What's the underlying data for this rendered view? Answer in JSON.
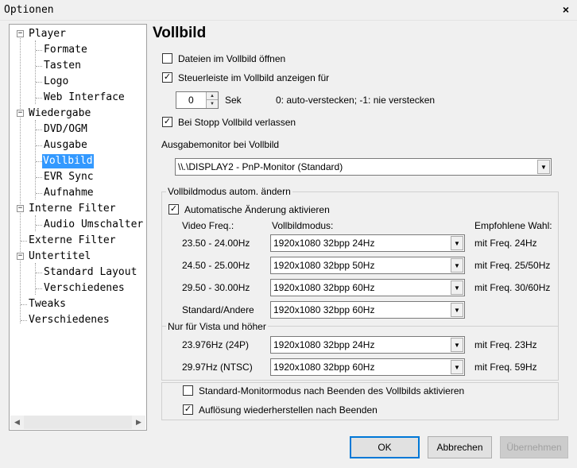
{
  "window": {
    "title": "Optionen",
    "close_glyph": "×"
  },
  "tree": {
    "items": [
      {
        "label": "Player",
        "level": 0,
        "expander": "⊟"
      },
      {
        "label": "Formate",
        "level": 1
      },
      {
        "label": "Tasten",
        "level": 1
      },
      {
        "label": "Logo",
        "level": 1
      },
      {
        "label": "Web Interface",
        "level": 1
      },
      {
        "label": "Wiedergabe",
        "level": 0,
        "expander": "⊟"
      },
      {
        "label": "DVD/OGM",
        "level": 1
      },
      {
        "label": "Ausgabe",
        "level": 1
      },
      {
        "label": "Vollbild",
        "level": 1,
        "selected": true
      },
      {
        "label": "EVR Sync",
        "level": 1
      },
      {
        "label": "Aufnahme",
        "level": 1
      },
      {
        "label": "Interne Filter",
        "level": 0,
        "expander": "⊟"
      },
      {
        "label": "Audio Umschalter",
        "level": 1
      },
      {
        "label": "Externe Filter",
        "level": 0
      },
      {
        "label": "Untertitel",
        "level": 0,
        "expander": "⊟"
      },
      {
        "label": "Standard Layout",
        "level": 1
      },
      {
        "label": "Verschiedenes",
        "level": 1
      },
      {
        "label": "Tweaks",
        "level": 0
      },
      {
        "label": "Verschiedenes",
        "level": 0
      }
    ]
  },
  "page": {
    "title": "Vollbild",
    "open_fullscreen": {
      "label": "Dateien im Vollbild öffnen",
      "checked": false
    },
    "show_toolbar": {
      "label": "Steuerleiste im Vollbild anzeigen für",
      "checked": true
    },
    "spin": {
      "value": "0",
      "unit": "Sek",
      "hint": "0: auto-verstecken; -1: nie verstecken"
    },
    "exit_on_stop": {
      "label": "Bei Stopp Vollbild verlassen",
      "checked": true
    },
    "monitor_label": "Ausgabemonitor bei Vollbild",
    "monitor_value": "\\\\.\\DISPLAY2 - PnP-Monitor (Standard)",
    "auto_group": {
      "title": "Vollbildmodus autom. ändern",
      "enable": {
        "label": "Automatische Änderung aktivieren",
        "checked": true
      },
      "headers": [
        "Video Freq.:",
        "Vollbildmodus:",
        "Empfohlene Wahl:"
      ],
      "rows": [
        {
          "freq": "23.50 - 24.00Hz",
          "mode": "1920x1080 32bpp 24Hz",
          "rec": "mit Freq. 24Hz"
        },
        {
          "freq": "24.50 - 25.00Hz",
          "mode": "1920x1080 32bpp 50Hz",
          "rec": "mit Freq. 25/50Hz"
        },
        {
          "freq": "29.50 - 30.00Hz",
          "mode": "1920x1080 32bpp 60Hz",
          "rec": "mit Freq. 30/60Hz"
        },
        {
          "freq": "Standard/Andere",
          "mode": "1920x1080 32bpp 60Hz",
          "rec": ""
        }
      ],
      "vista_title": "Nur für Vista und höher",
      "vista_rows": [
        {
          "freq": "23.976Hz (24P)",
          "mode": "1920x1080 32bpp 24Hz",
          "rec": "mit Freq. 23Hz"
        },
        {
          "freq": "29.97Hz (NTSC)",
          "mode": "1920x1080 32bpp 60Hz",
          "rec": "mit Freq. 59Hz"
        }
      ]
    },
    "restore_monitor": {
      "label": "Standard-Monitormodus nach Beenden des Vollbilds aktivieren",
      "checked": false
    },
    "restore_resolution": {
      "label": "Auflösung wiederherstellen nach Beenden",
      "checked": true
    }
  },
  "buttons": {
    "ok": "OK",
    "cancel": "Abbrechen",
    "apply": "Übernehmen"
  },
  "glyphs": {
    "check": "✓",
    "dropdown": "▼",
    "up": "▲",
    "down": "▼",
    "left": "◀",
    "right": "▶"
  }
}
